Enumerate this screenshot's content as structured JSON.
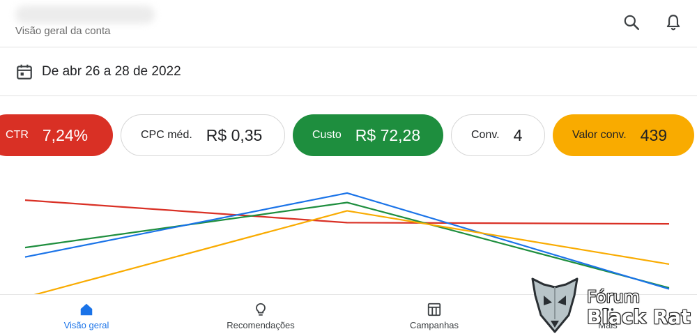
{
  "header": {
    "subtitle": "Visão geral da conta",
    "search_icon": "search-icon",
    "bell_icon": "bell-icon"
  },
  "date_range": {
    "icon": "calendar-icon",
    "label": "De abr 26 a 28 de 2022"
  },
  "metrics": [
    {
      "label": "CTR",
      "value": "7,24%",
      "selected": true,
      "color": "#d93025"
    },
    {
      "label": "CPC méd.",
      "value": "R$ 0,35",
      "selected": false,
      "color": "#ffffff"
    },
    {
      "label": "Custo",
      "value": "R$ 72,28",
      "selected": true,
      "color": "#1e8e3e"
    },
    {
      "label": "Conv.",
      "value": "4",
      "selected": false,
      "color": "#ffffff"
    },
    {
      "label": "Valor conv.",
      "value": "439",
      "selected": true,
      "color": "#f9ab00"
    }
  ],
  "chart_data": {
    "type": "line",
    "title": "",
    "xlabel": "",
    "ylabel": "",
    "x": [
      "2022-04-26",
      "2022-04-27",
      "2022-04-28"
    ],
    "grid": false,
    "series": [
      {
        "color": "#d93025",
        "values": [
          0.77,
          0.58,
          0.57
        ]
      },
      {
        "color": "#1e8e3e",
        "values": [
          0.37,
          0.75,
          0.03
        ]
      },
      {
        "color": "#1a73e8",
        "values": [
          0.29,
          0.83,
          0.02
        ]
      },
      {
        "color": "#f9ab00",
        "values": [
          -0.05,
          0.68,
          0.23
        ]
      }
    ],
    "ylim": [
      0,
      1
    ]
  },
  "bottom_nav": [
    {
      "label": "Visão geral",
      "icon": "home-icon",
      "active": true
    },
    {
      "label": "Recomendações",
      "icon": "lightbulb-icon",
      "active": false
    },
    {
      "label": "Campanhas",
      "icon": "campaigns-icon",
      "active": false
    },
    {
      "label": "Mais",
      "icon": "more-icon",
      "active": false
    }
  ],
  "watermark": {
    "line1": "Fórum",
    "line2": "Black Rat"
  }
}
